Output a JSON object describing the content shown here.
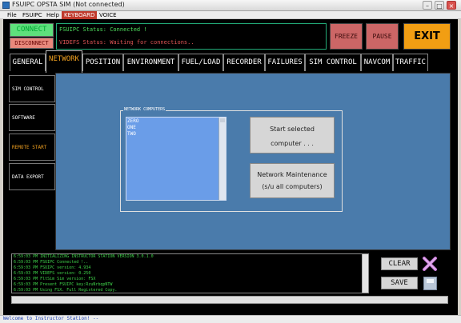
{
  "window": {
    "title": "FSUIPC OPSTA SIM (Not connected)",
    "minimize_label": "–",
    "maximize_label": "□",
    "close_label": "×"
  },
  "menu": [
    "File",
    "FSUIPC",
    "Help",
    "KEYBOARD",
    "VOICE"
  ],
  "top": {
    "connect_label": "CONNECT",
    "disconnect_label": "DISCONNECT",
    "fsuipc_status": "FSUIPC Status: Connected !",
    "videfs_status": "VIDEFS Status: Waiting for connections..",
    "freeze_label": "FREEZE",
    "pause_label": "PAUSE",
    "exit_label": "EXIT"
  },
  "tabs": [
    "GENERAL",
    "NETWORK",
    "POSITION",
    "ENVIRONMENT",
    "FUEL/LOAD",
    "RECORDER",
    "FAILURES",
    "SIM CONTROL",
    "NAVCOM",
    "TRAFFIC"
  ],
  "active_tab": "NETWORK",
  "sidenav": [
    "SIM CONTROL",
    "SOFTWARE",
    "REMOTE START",
    "DATA EXPORT"
  ],
  "active_sidenav": "REMOTE START",
  "network": {
    "group_label": "NETWORK COMPUTERS",
    "computers": [
      "ZERO",
      "ONE",
      "TWO"
    ],
    "start_line1": "Start selected",
    "start_line2": "computer . . .",
    "maint_line1": "Network Maintenance",
    "maint_line2": "(s/u all computers)"
  },
  "log": [
    "6:59:03 PM INITIALIZING INSTRUCTOR STATION VERSION 3.0.1.0",
    "6:59:03 PM FSUIPC Connected !..",
    "6:59:03 PM FSUIPC version: 4.934",
    "6:59:03 PM VIDEFS version: 0.250",
    "6:59:03 PM FltSim Sim version: FSX",
    "6:59:03 PM Present FSUIPC key:RzuNrbqpNTW",
    "6:59:03 PM Using FSX. Full Registered Copy."
  ],
  "log_buttons": {
    "clear_label": "CLEAR",
    "save_label": "SAVE"
  },
  "statusbar": "Welcome to Instructor Station! --",
  "colors": {
    "panel_bg": "#4a7bab",
    "list_bg": "#6a9de8",
    "connect": "#5ee07c",
    "disconnect": "#e8887c",
    "exit": "#f29e13",
    "freeze_pause": "#cc6666",
    "log_text": "#3fd34a",
    "active_tab_text": "#f0a020"
  }
}
